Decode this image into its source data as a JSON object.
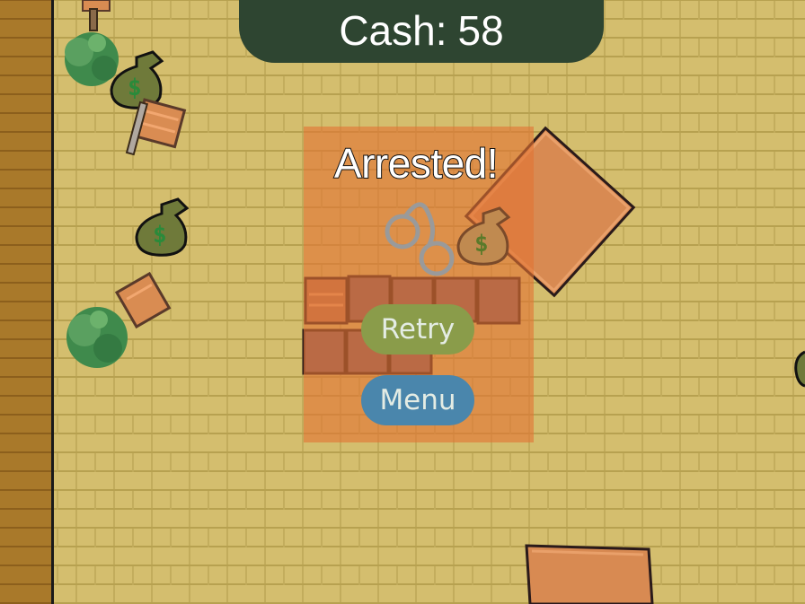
{
  "hud": {
    "cash_label": "Cash:",
    "cash_value": "58"
  },
  "dialog": {
    "title": "Arrested!",
    "retry_label": "Retry",
    "menu_label": "Menu",
    "icons": [
      "handcuffs-icon",
      "money-bag-icon"
    ]
  },
  "scene": {
    "money_bag_symbol": "$",
    "colors": {
      "floor": "#d4be6e",
      "wall": "#a9792a",
      "panel": "#2e4531",
      "overlay": "#e27434",
      "retry": "#8a9c4a",
      "menu": "#4a86ac"
    }
  }
}
